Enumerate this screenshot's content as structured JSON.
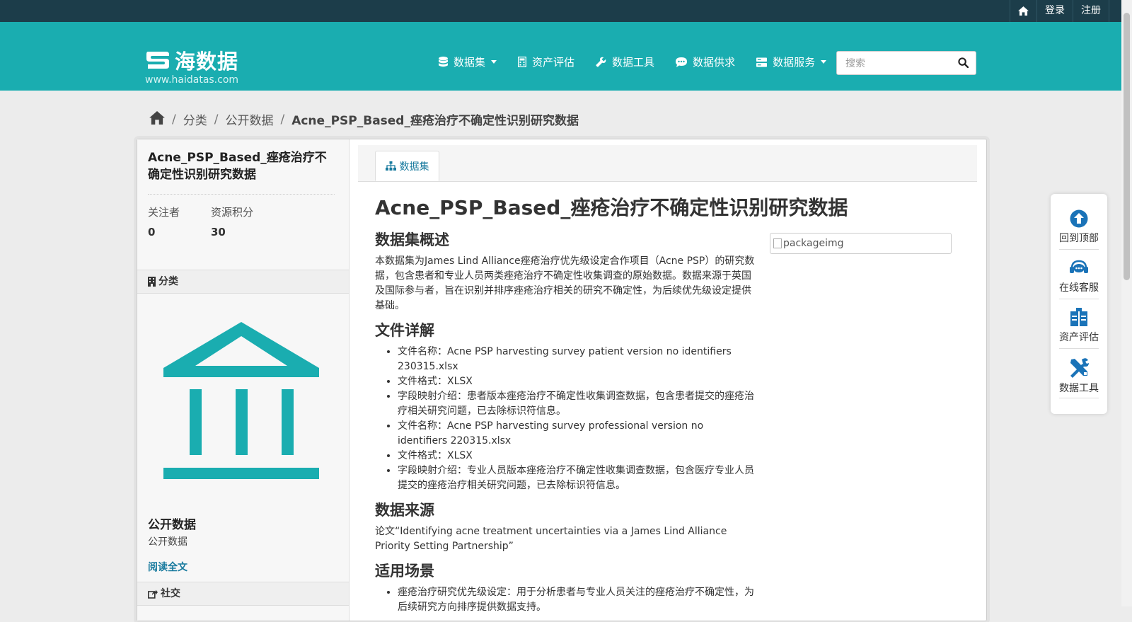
{
  "topbar": {
    "login": "登录",
    "register": "注册"
  },
  "header": {
    "logo_text": "海数据",
    "logo_url": "www.haidatas.com",
    "nav": [
      {
        "label": "数据集",
        "icon": "database-icon",
        "dropdown": true
      },
      {
        "label": "资产评估",
        "icon": "calculator-icon",
        "dropdown": false
      },
      {
        "label": "数据工具",
        "icon": "wrench-icon",
        "dropdown": false
      },
      {
        "label": "数据供求",
        "icon": "comment-icon",
        "dropdown": false
      },
      {
        "label": "数据服务",
        "icon": "server-icon",
        "dropdown": true
      }
    ],
    "search_placeholder": "搜索"
  },
  "breadcrumb": {
    "items": [
      "分类",
      "公开数据"
    ],
    "current": "Acne_PSP_Based_痤疮治疗不确定性识别研究数据"
  },
  "sidebar": {
    "title": "Acne_PSP_Based_痤疮治疗不确定性识别研究数据",
    "stats": [
      {
        "label": "关注者",
        "value": "0"
      },
      {
        "label": "资源积分",
        "value": "30"
      }
    ],
    "category_heading": "分类",
    "org_title": "公开数据",
    "org_desc": "公开数据",
    "read_more": "阅读全文",
    "social_heading": "社交"
  },
  "content": {
    "tab_label": "数据集",
    "title": "Acne_PSP_Based_痤疮治疗不确定性识别研究数据",
    "image_alt": "packageimg",
    "sections": {
      "overview_heading": "数据集概述",
      "overview_text": "本数据集为James Lind Alliance痤疮治疗优先级设定合作项目（Acne PSP）的研究数据，包含患者和专业人员两类痤疮治疗不确定性收集调查的原始数据。数据来源于英国及国际参与者，旨在识别并排序痤疮治疗相关的研究不确定性，为后续优先级设定提供基础。",
      "files_heading": "文件详解",
      "files": [
        "文件名称：Acne PSP harvesting survey patient version no identifiers 230315.xlsx",
        "文件格式：XLSX",
        "字段映射介绍：患者版本痤疮治疗不确定性收集调查数据，包含患者提交的痤疮治疗相关研究问题，已去除标识符信息。",
        "文件名称：Acne PSP harvesting survey professional version no identifiers 220315.xlsx",
        "文件格式：XLSX",
        "字段映射介绍：专业人员版本痤疮治疗不确定性收集调查数据，包含医疗专业人员提交的痤疮治疗相关研究问题，已去除标识符信息。"
      ],
      "source_heading": "数据来源",
      "source_text": "论文“Identifying acne treatment uncertainties via a James Lind Alliance Priority Setting Partnership”",
      "usage_heading": "适用场景",
      "usage": [
        "痤疮治疗研究优先级设定：用于分析患者与专业人员关注的痤疮治疗不确定性，为后续研究方向排序提供数据支持。"
      ]
    }
  },
  "float_panel": [
    {
      "label": "回到顶部",
      "icon": "arrow-up-circle-icon"
    },
    {
      "label": "在线客服",
      "icon": "headset-icon"
    },
    {
      "label": "资产评估",
      "icon": "clipboard-icon"
    },
    {
      "label": "数据工具",
      "icon": "tools-icon"
    }
  ],
  "colors": {
    "topbar": "#1c3d4a",
    "header": "#1aadb0",
    "accent": "#187a9e",
    "icon_blue": "#1a73b8"
  }
}
